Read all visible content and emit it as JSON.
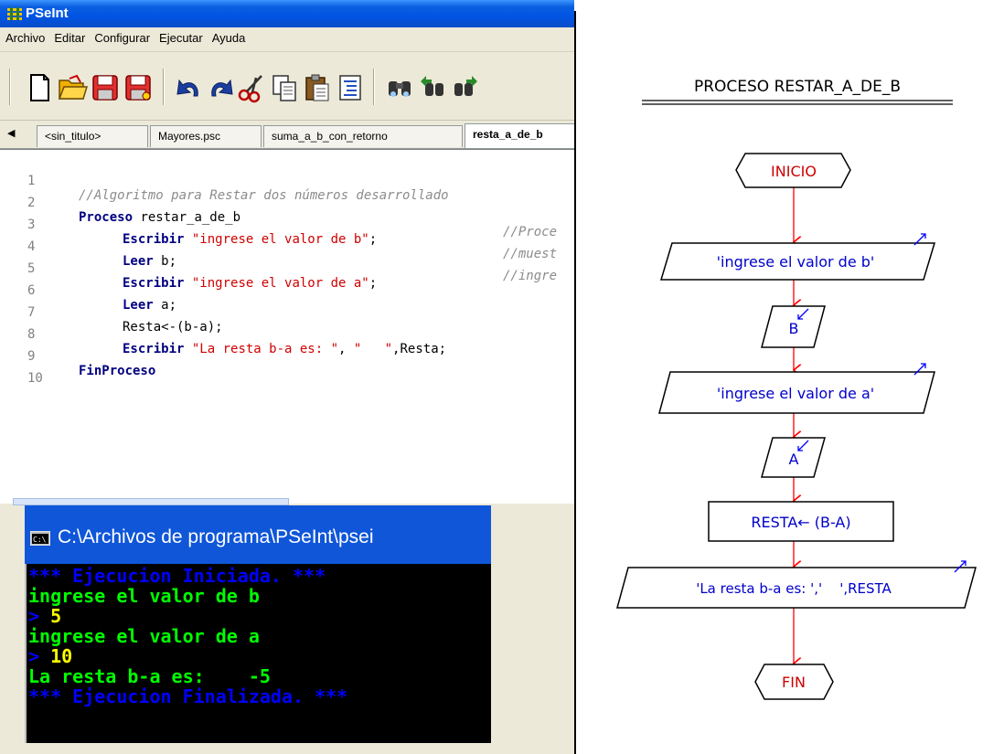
{
  "window": {
    "title": "PSeInt"
  },
  "menu": [
    "Archivo",
    "Editar",
    "Configurar",
    "Ejecutar",
    "Ayuda"
  ],
  "toolbar": [
    {
      "icon": "new-file-icon"
    },
    {
      "icon": "open-folder-icon"
    },
    {
      "icon": "save-icon"
    },
    {
      "icon": "save-as-icon"
    },
    {
      "icon": "undo-icon"
    },
    {
      "icon": "redo-icon"
    },
    {
      "icon": "cut-icon"
    },
    {
      "icon": "copy-icon"
    },
    {
      "icon": "paste-icon"
    },
    {
      "icon": "indent-icon"
    },
    {
      "icon": "find-icon"
    },
    {
      "icon": "find-previous-icon"
    },
    {
      "icon": "find-next-icon"
    }
  ],
  "tabs": [
    "<sin_titulo>",
    "Mayores.psc",
    "suma_a_b_con_retorno",
    "resta_a_de_b"
  ],
  "editor": {
    "lines": [
      {
        "n": "1"
      },
      {
        "n": "2"
      },
      {
        "n": "3"
      },
      {
        "n": "4"
      },
      {
        "n": "5"
      },
      {
        "n": "6"
      },
      {
        "n": "7"
      },
      {
        "n": "8"
      },
      {
        "n": "9"
      },
      {
        "n": "10"
      }
    ],
    "l1_comment": "//Algoritmo para Restar dos números desarrollado",
    "l2_kw": "Proceso",
    "l2_name": " restar_a_de_b",
    "l2_comment": "//Proce",
    "l3_kw": "Escribir",
    "l3_str": "\"ingrese el valor de b\"",
    "l3_end": ";",
    "l3_comment": "//muest",
    "l4_kw": "Leer",
    "l4_rest": " b;",
    "l4_comment": "//ingre",
    "l5_kw": "Escribir",
    "l5_str": "\"ingrese el valor de a\"",
    "l5_end": ";",
    "l6_kw": "Leer",
    "l6_rest": " a;",
    "l7_text": "Resta<-(b-a);",
    "l8_kw": "Escribir",
    "l8_str1": "\"La resta b-a es: \"",
    "l8_sep": ", ",
    "l8_str2": "\"   \"",
    "l8_end": ",Resta;",
    "l9_kw": "FinProceso"
  },
  "console": {
    "title": "C:\\Archivos de programa\\PSeInt\\psei",
    "lines": [
      {
        "text": "*** Ejecucion Iniciada. ***",
        "color": "blue"
      },
      {
        "text": "ingrese el valor de b",
        "color": "green"
      },
      {
        "prompt": ">",
        "value": "5"
      },
      {
        "text": "ingrese el valor de a",
        "color": "green"
      },
      {
        "prompt": ">",
        "value": "10"
      },
      {
        "text": "La resta b-a es:    -5",
        "color": "green"
      },
      {
        "text": "*** Ejecucion Finalizada. ***",
        "color": "blue"
      }
    ]
  },
  "flowchart": {
    "title": "PROCESO RESTAR_A_DE_B",
    "start": "INICIO",
    "out_b": "'ingrese el valor de b'",
    "in_b": "B",
    "out_a": "'ingrese el valor de a'",
    "in_a": "A",
    "assign": "RESTA← (B-A)",
    "out_result": "'La resta b-a es: ','    ',RESTA",
    "end": "FIN",
    "colors": {
      "arrow": "#ff0000",
      "node_text": "#0000cc",
      "start_text": "#cc0000",
      "io_marker": "#0000ff"
    }
  }
}
